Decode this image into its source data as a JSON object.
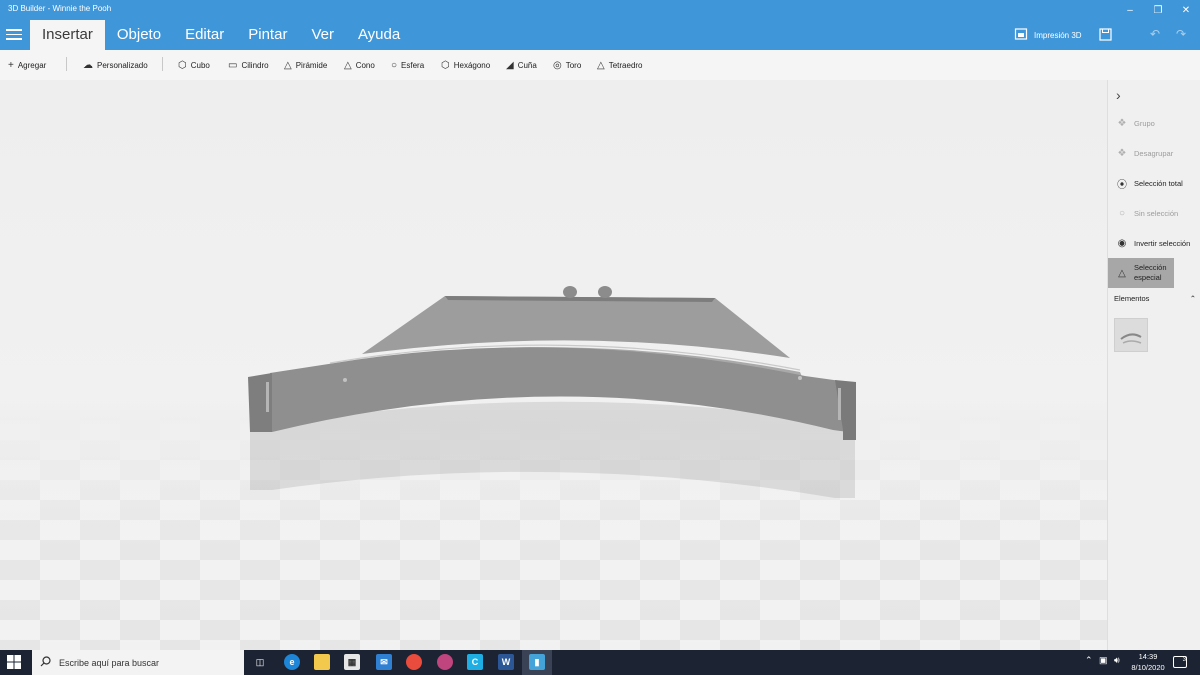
{
  "window": {
    "title": "3D Builder - Winnie the Pooh",
    "controls": [
      "minimize",
      "restore",
      "close"
    ]
  },
  "menu": {
    "tabs": [
      {
        "label": "Insertar",
        "active": true
      },
      {
        "label": "Objeto"
      },
      {
        "label": "Editar"
      },
      {
        "label": "Pintar"
      },
      {
        "label": "Ver"
      },
      {
        "label": "Ayuda"
      }
    ],
    "print_label": "Impresión 3D",
    "icons": [
      "hamburger-icon",
      "printer-icon",
      "save-icon",
      "undo-icon",
      "redo-icon"
    ]
  },
  "toolbar": {
    "add": "Agregar",
    "custom": "Personalizado",
    "shapes": [
      "Cubo",
      "Cilindro",
      "Pirámide",
      "Cono",
      "Esfera",
      "Hexágono",
      "Cuña",
      "Toro",
      "Tetraedro"
    ]
  },
  "panel": {
    "group": "Grupo",
    "ungroup": "Desagrupar",
    "select_all": "Selección total",
    "select_none": "Sin selección",
    "invert": "Invertir selección",
    "special_line1": "Selección",
    "special_line2": "especial",
    "elements": "Elementos",
    "disabled_items": [
      "Grupo",
      "Desagrupar",
      "Sin selección"
    ],
    "selected_item": "Selección especial"
  },
  "taskbar": {
    "search_placeholder": "Escribe aquí para buscar",
    "time": "14:39",
    "date": "8/10/2020",
    "notifications": "3",
    "apps": [
      "task-view",
      "edge",
      "file-explorer",
      "store",
      "mail",
      "chrome",
      "app-pink",
      "app-c",
      "word",
      "3d-builder"
    ]
  },
  "colors": {
    "accent": "#3f96d9",
    "taskbar": "#1c2433",
    "viewport": "#ececec",
    "model": "#8f8f8f"
  }
}
